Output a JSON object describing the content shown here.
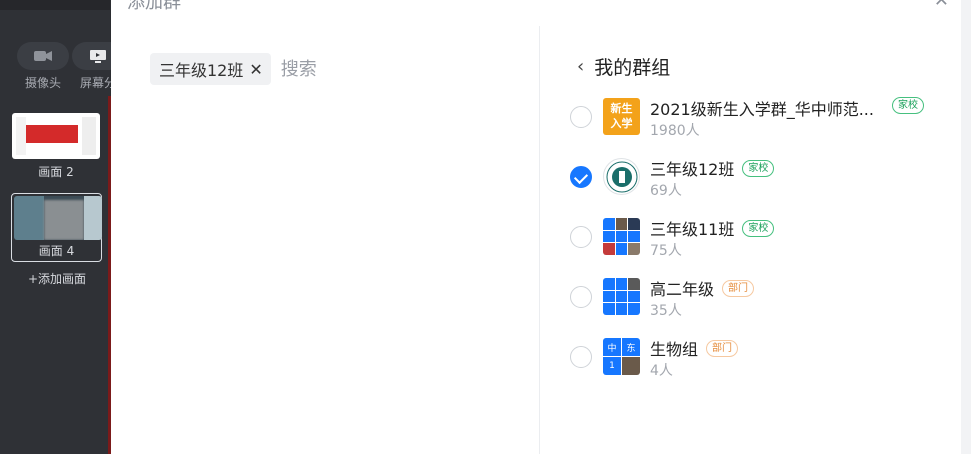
{
  "left_panel": {
    "tools": [
      {
        "label": "摄像头",
        "icon": "camera-icon"
      },
      {
        "label": "屏幕分",
        "icon": "screen-share-icon"
      }
    ],
    "scenes": [
      {
        "label": "画面 2"
      },
      {
        "label": "画面 4"
      }
    ],
    "add_scene": "+添加画面"
  },
  "modal": {
    "title": "添加群",
    "close": "✕",
    "selected_chip": "三年级12班",
    "chip_remove": "✕",
    "search_placeholder": "搜索",
    "group_header": "我的群组",
    "back": "‹",
    "groups": [
      {
        "name": "2021级新生入学群_华中师范...",
        "count": "1980人",
        "tag": "家校",
        "avatar_text": [
          "新生",
          "入学"
        ],
        "checked": false
      },
      {
        "name": "三年级12班",
        "count": "69人",
        "tag": "家校",
        "checked": true
      },
      {
        "name": "三年级11班",
        "count": "75人",
        "tag": "家校",
        "checked": false
      },
      {
        "name": "高二年级",
        "count": "35人",
        "tag": "部门",
        "checked": false
      },
      {
        "name": "生物组",
        "count": "4人",
        "tag": "部门",
        "avatar_text": [
          "中",
          "东",
          "1"
        ],
        "checked": false
      }
    ]
  },
  "colors": {
    "accent": "#1677ff",
    "school_tag": "#1aa05a",
    "dept_tag": "#e58b3a",
    "dark_panel": "#2f3136"
  }
}
